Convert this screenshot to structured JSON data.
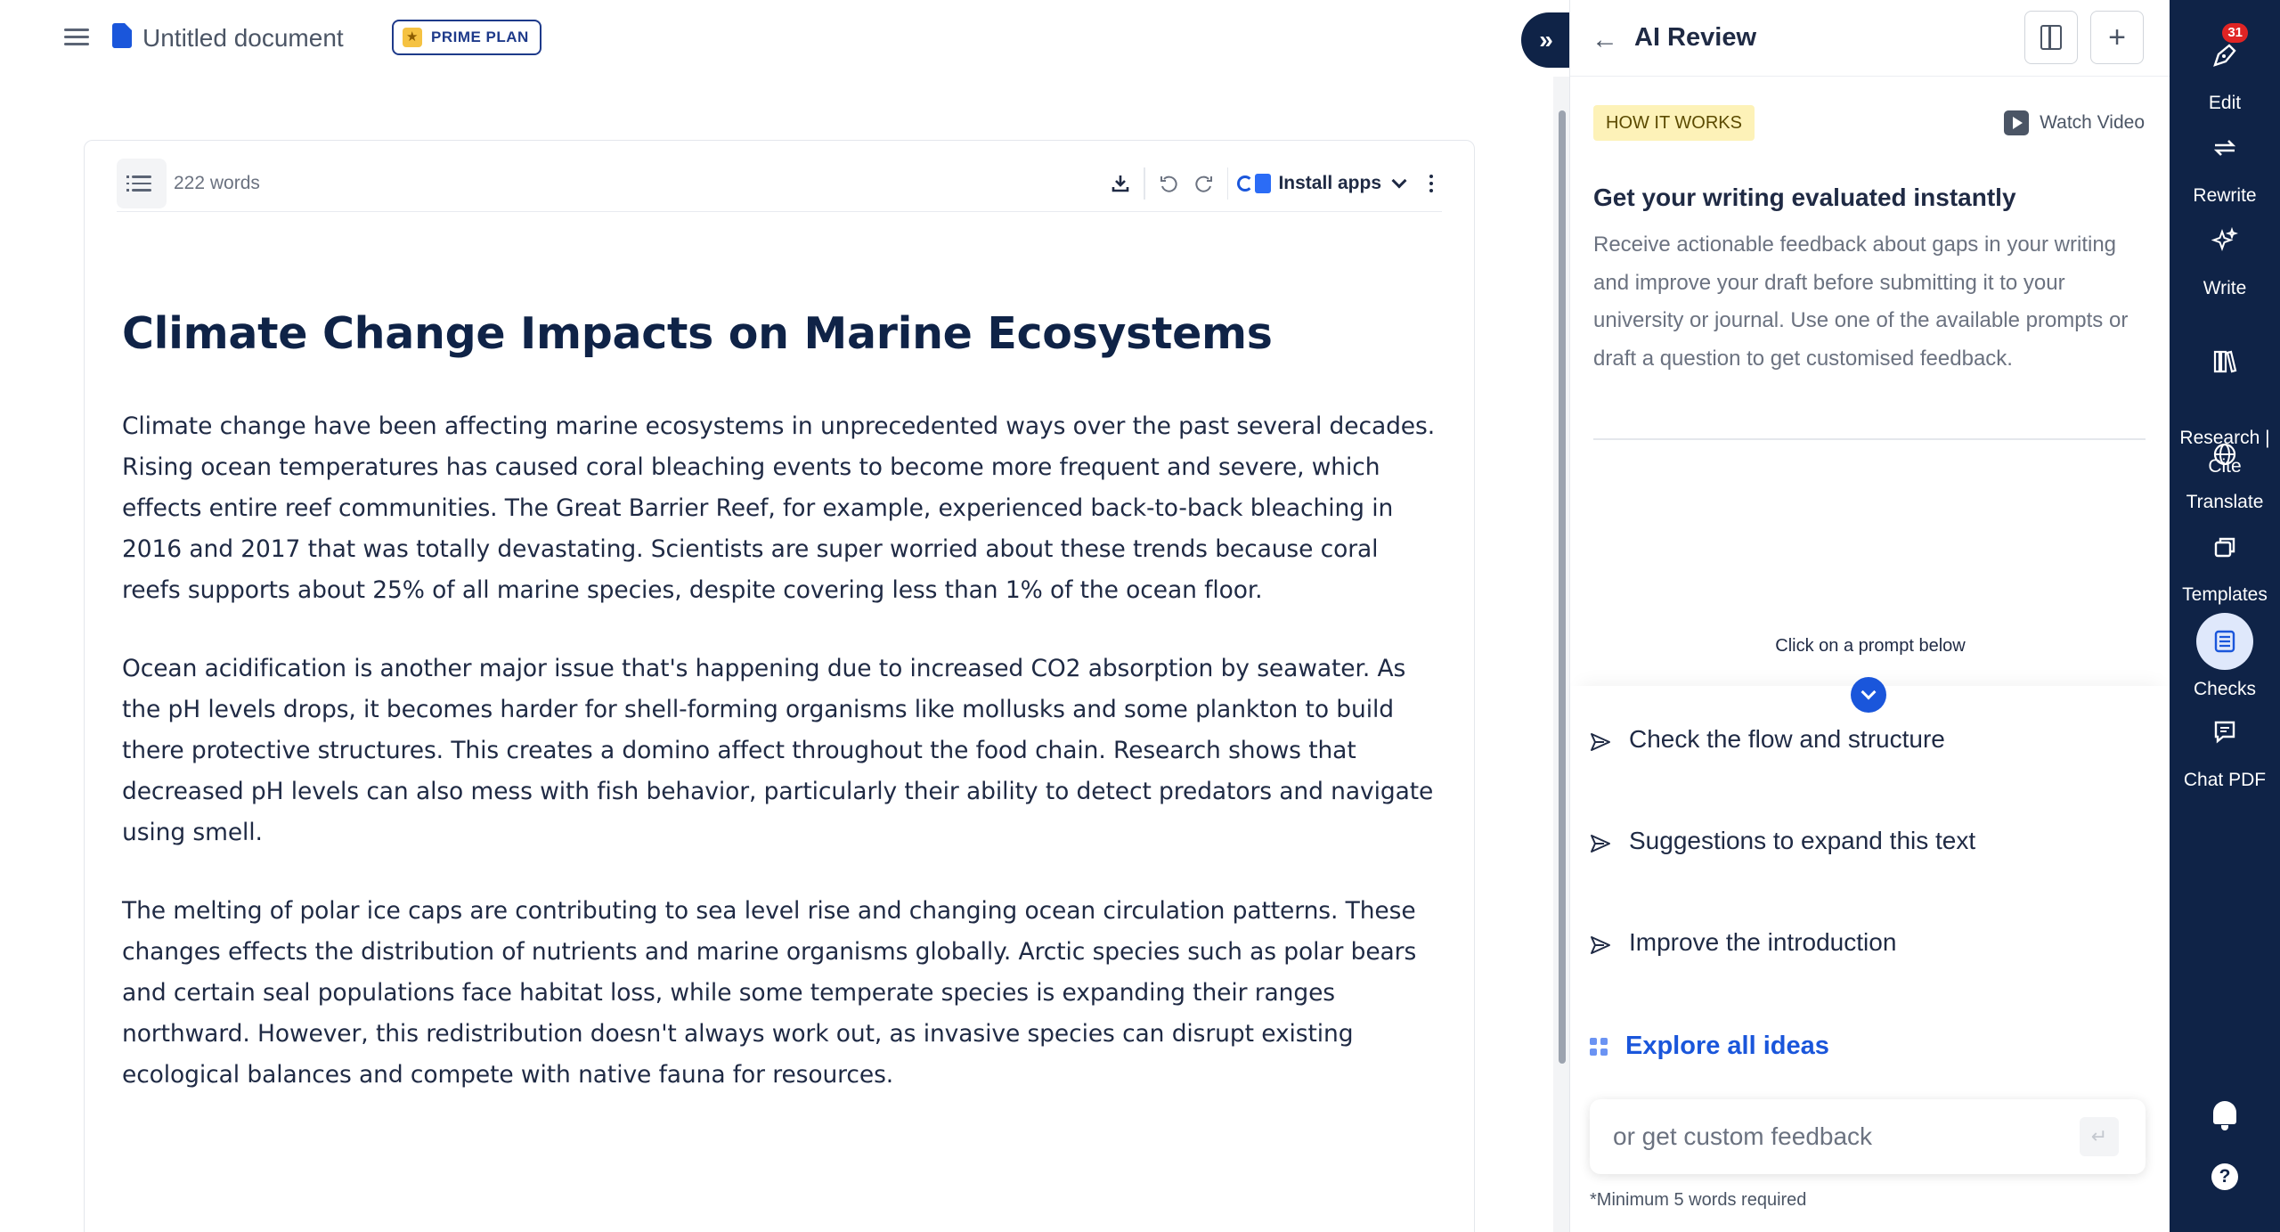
{
  "topbar": {
    "doc_title": "Untitled document",
    "plan_badge": "PRIME PLAN"
  },
  "editor": {
    "word_count": "222 words",
    "install_apps": "Install apps",
    "heading": "Climate Change Impacts on Marine Ecosystems",
    "paragraphs": [
      "Climate change have been affecting marine ecosystems in unprecedented ways over the past several decades. Rising ocean temperatures has caused coral bleaching events to become more frequent and severe, which effects entire reef communities. The Great Barrier Reef, for example, experienced back-to-back bleaching in 2016 and 2017 that was totally devastating. Scientists are super worried about these trends because coral reefs supports about 25% of all marine species, despite covering less than 1% of the ocean floor.",
      "Ocean acidification is another major issue that's happening due to increased CO2 absorption by seawater. As the pH levels drops, it becomes harder for shell-forming organisms like mollusks and some plankton to build there protective structures. This creates a domino affect throughout the food chain. Research shows that decreased pH levels can also mess with fish behavior, particularly their ability to detect predators and navigate using smell.",
      "The melting of polar ice caps are contributing to sea level rise and changing ocean circulation patterns. These changes effects the distribution of nutrients and marine organisms globally. Arctic species such as polar bears and certain seal populations face habitat loss, while some temperate species is expanding their ranges northward. However, this redistribution doesn't always work out, as invasive species can disrupt existing ecological balances and compete with native fauna for resources."
    ]
  },
  "panel": {
    "title": "AI Review",
    "how_it_works": "HOW IT WORKS",
    "watch_video": "Watch Video",
    "eval_title": "Get your writing evaluated instantly",
    "eval_desc": "Receive actionable feedback about gaps in your writing and improve your draft before submitting it to your university or journal. Use one of the available prompts or draft a question to get customised feedback.",
    "click_prompt": "Click on a prompt below",
    "prompts": [
      "Check the flow and structure",
      "Suggestions to expand this text",
      "Improve the introduction"
    ],
    "explore": "Explore all ideas",
    "custom_placeholder": "or get custom feedback",
    "min_note": "*Minimum 5 words required"
  },
  "rail": {
    "notification_count": "31",
    "items": [
      {
        "label": "Edit",
        "icon": "pen-nib-icon"
      },
      {
        "label": "Rewrite",
        "icon": "repeat-arrows-icon"
      },
      {
        "label": "Write",
        "icon": "sparkle-icon"
      },
      {
        "label": "Research |\nCite",
        "icon": "library-books-icon"
      },
      {
        "label": "Translate",
        "icon": "globe-icon"
      },
      {
        "label": "Templates",
        "icon": "copy-stack-icon"
      },
      {
        "label": "Checks",
        "icon": "checklist-icon"
      },
      {
        "label": "Chat PDF",
        "icon": "chat-document-icon"
      }
    ],
    "active": "Checks"
  },
  "colors": {
    "navy": "#0f2347",
    "accent_blue": "#1a56db",
    "badge_yellow": "#fdf2b8",
    "notification_red": "#e02424"
  }
}
